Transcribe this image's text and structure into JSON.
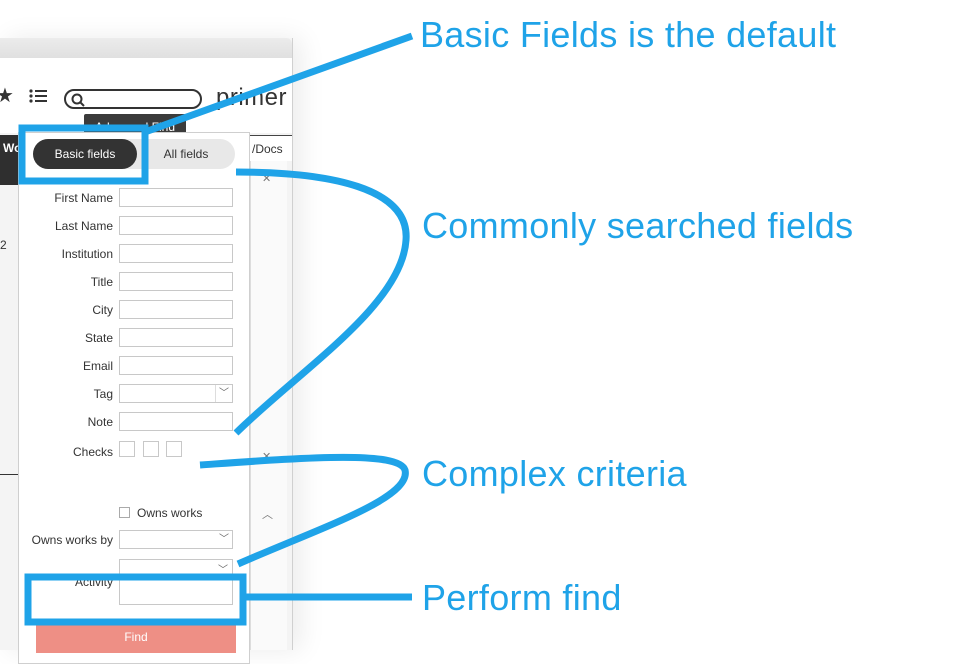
{
  "toolbar": {
    "brand": "primer",
    "search_placeholder": "",
    "tooltip": "Advanced Find"
  },
  "background": {
    "left_tab": "Wo",
    "docs_header": "/Docs",
    "row_number": "2"
  },
  "panel": {
    "tabs": [
      {
        "label": "Basic fields",
        "active": true
      },
      {
        "label": "All fields",
        "active": false
      }
    ],
    "text_fields": [
      {
        "label": "First Name",
        "value": ""
      },
      {
        "label": "Last Name",
        "value": ""
      },
      {
        "label": "Institution",
        "value": ""
      },
      {
        "label": "Title",
        "value": ""
      },
      {
        "label": "City",
        "value": ""
      },
      {
        "label": "State",
        "value": ""
      },
      {
        "label": "Email",
        "value": ""
      }
    ],
    "tag": {
      "label": "Tag",
      "value": ""
    },
    "note": {
      "label": "Note",
      "value": ""
    },
    "checks": {
      "label": "Checks"
    },
    "owns_works": {
      "label": "Owns works",
      "checked": false
    },
    "owns_works_by": {
      "label": "Owns works by",
      "value": ""
    },
    "activity": {
      "label": "Activity",
      "value": ""
    },
    "find_button": "Find",
    "find_color": "#ee8f85"
  },
  "annotations": {
    "basic_fields": "Basic Fields is the default",
    "common_fields": "Commonly searched fields",
    "complex": "Complex criteria",
    "perform": "Perform find",
    "color": "#1fa3e8"
  }
}
